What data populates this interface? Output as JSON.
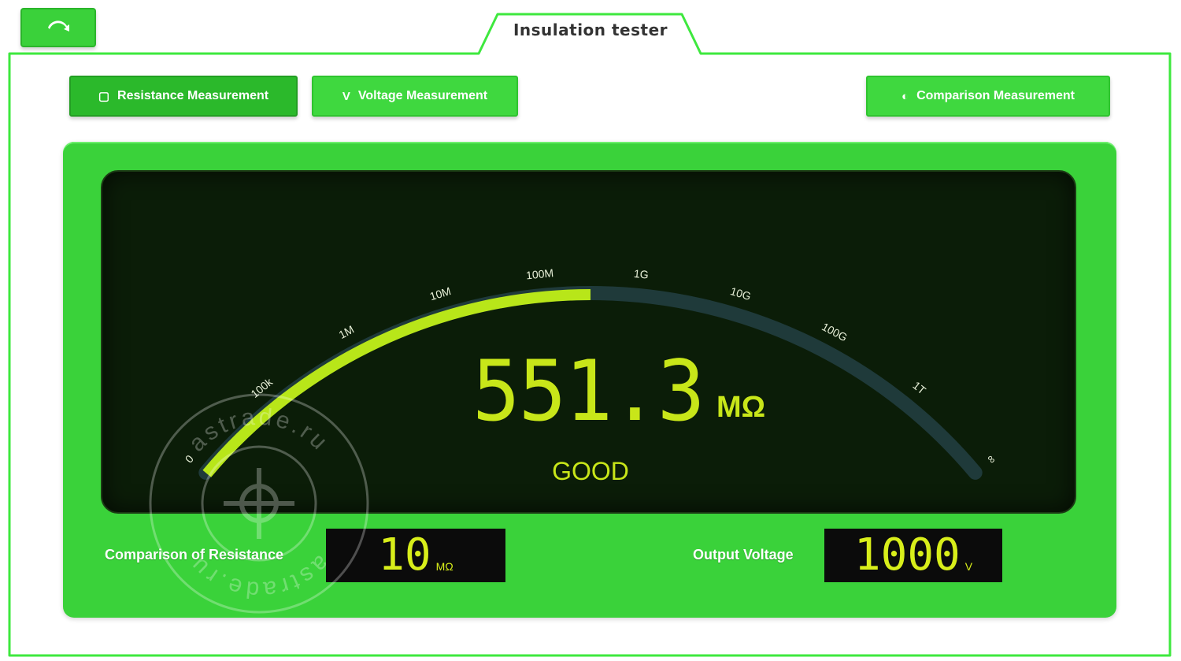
{
  "app": {
    "title": "Insulation tester"
  },
  "nav": {
    "home_icon": "home-arrow-icon"
  },
  "modes": [
    {
      "label": "Resistance Measurement",
      "icon": "square-icon",
      "glyph": "▢",
      "active": true
    },
    {
      "label": "Voltage Measurement",
      "icon": "v-icon",
      "glyph": "V",
      "active": false
    },
    {
      "label": "Comparison Measurement",
      "icon": "compare-icon",
      "glyph": "◐",
      "active": false
    }
  ],
  "gauge": {
    "scale_labels": [
      "0",
      "100k",
      "1M",
      "10M",
      "100M",
      "1G",
      "10G",
      "100G",
      "1T",
      "∞"
    ],
    "fill_fraction": 0.5
  },
  "reading": {
    "value": "551.3",
    "unit": "MΩ",
    "status": "GOOD"
  },
  "comparison": {
    "label": "Comparison of Resistance",
    "value": "10",
    "unit": "MΩ"
  },
  "output": {
    "label": "Output Voltage",
    "value": "1000",
    "unit": "V"
  },
  "watermark": {
    "text": "astrade.ru"
  },
  "colors": {
    "accent": "#3ad23a",
    "display": "#c8e619",
    "screen_bg": "#0b1d08"
  }
}
